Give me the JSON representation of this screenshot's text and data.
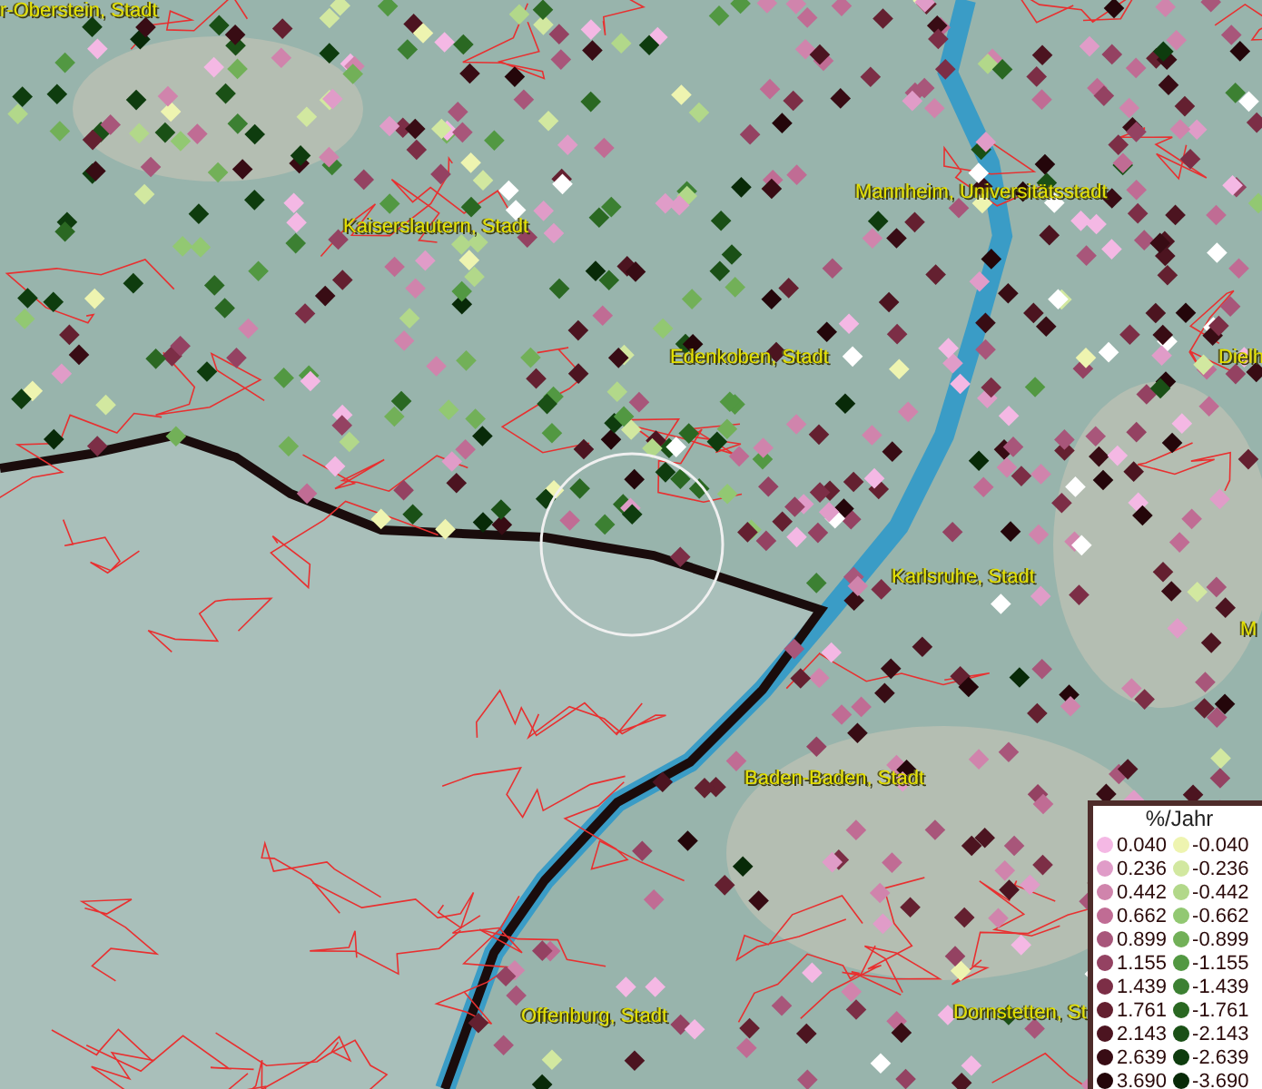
{
  "map": {
    "labels": [
      {
        "text": "r-Oberstein, Stadt"
      },
      {
        "text": "Kaiserslautern, Stadt"
      },
      {
        "text": "Mannheim, Universitätsstadt"
      },
      {
        "text": "Edenkoben, Stadt"
      },
      {
        "text": "Dielh"
      },
      {
        "text": "Karlsruhe, Stadt"
      },
      {
        "text": "M"
      },
      {
        "text": "Baden-Baden, Stadt"
      },
      {
        "text": "Offenburg, Stadt"
      },
      {
        "text": "Dornstetten, St"
      }
    ]
  },
  "legend": {
    "title": "%/Jahr",
    "columns": [
      [
        {
          "label": "0.040",
          "color": "#f4b8e4"
        },
        {
          "label": "0.236",
          "color": "#e09cc8"
        },
        {
          "label": "0.442",
          "color": "#d084ac"
        },
        {
          "label": "0.662",
          "color": "#c06c94"
        },
        {
          "label": "0.899",
          "color": "#a8567a"
        },
        {
          "label": "1.155",
          "color": "#944262"
        },
        {
          "label": "1.439",
          "color": "#7c2e46"
        },
        {
          "label": "1.761",
          "color": "#642030"
        },
        {
          "label": "2.143",
          "color": "#4c1420"
        },
        {
          "label": "2.639",
          "color": "#380c14"
        },
        {
          "label": "3.690",
          "color": "#24060a"
        }
      ],
      [
        {
          "label": "-0.040",
          "color": "#eef4b0"
        },
        {
          "label": "-0.236",
          "color": "#d2e8a0"
        },
        {
          "label": "-0.442",
          "color": "#b2d88a"
        },
        {
          "label": "-0.662",
          "color": "#92c872"
        },
        {
          "label": "-0.899",
          "color": "#72b058"
        },
        {
          "label": "-1.155",
          "color": "#529842"
        },
        {
          "label": "-1.439",
          "color": "#3c8032"
        },
        {
          "label": "-1.761",
          "color": "#2a6822"
        },
        {
          "label": "-2.143",
          "color": "#1a5016"
        },
        {
          "label": "-2.639",
          "color": "#0e3c0e"
        },
        {
          "label": "-3.690",
          "color": "#082a08"
        }
      ]
    ]
  }
}
